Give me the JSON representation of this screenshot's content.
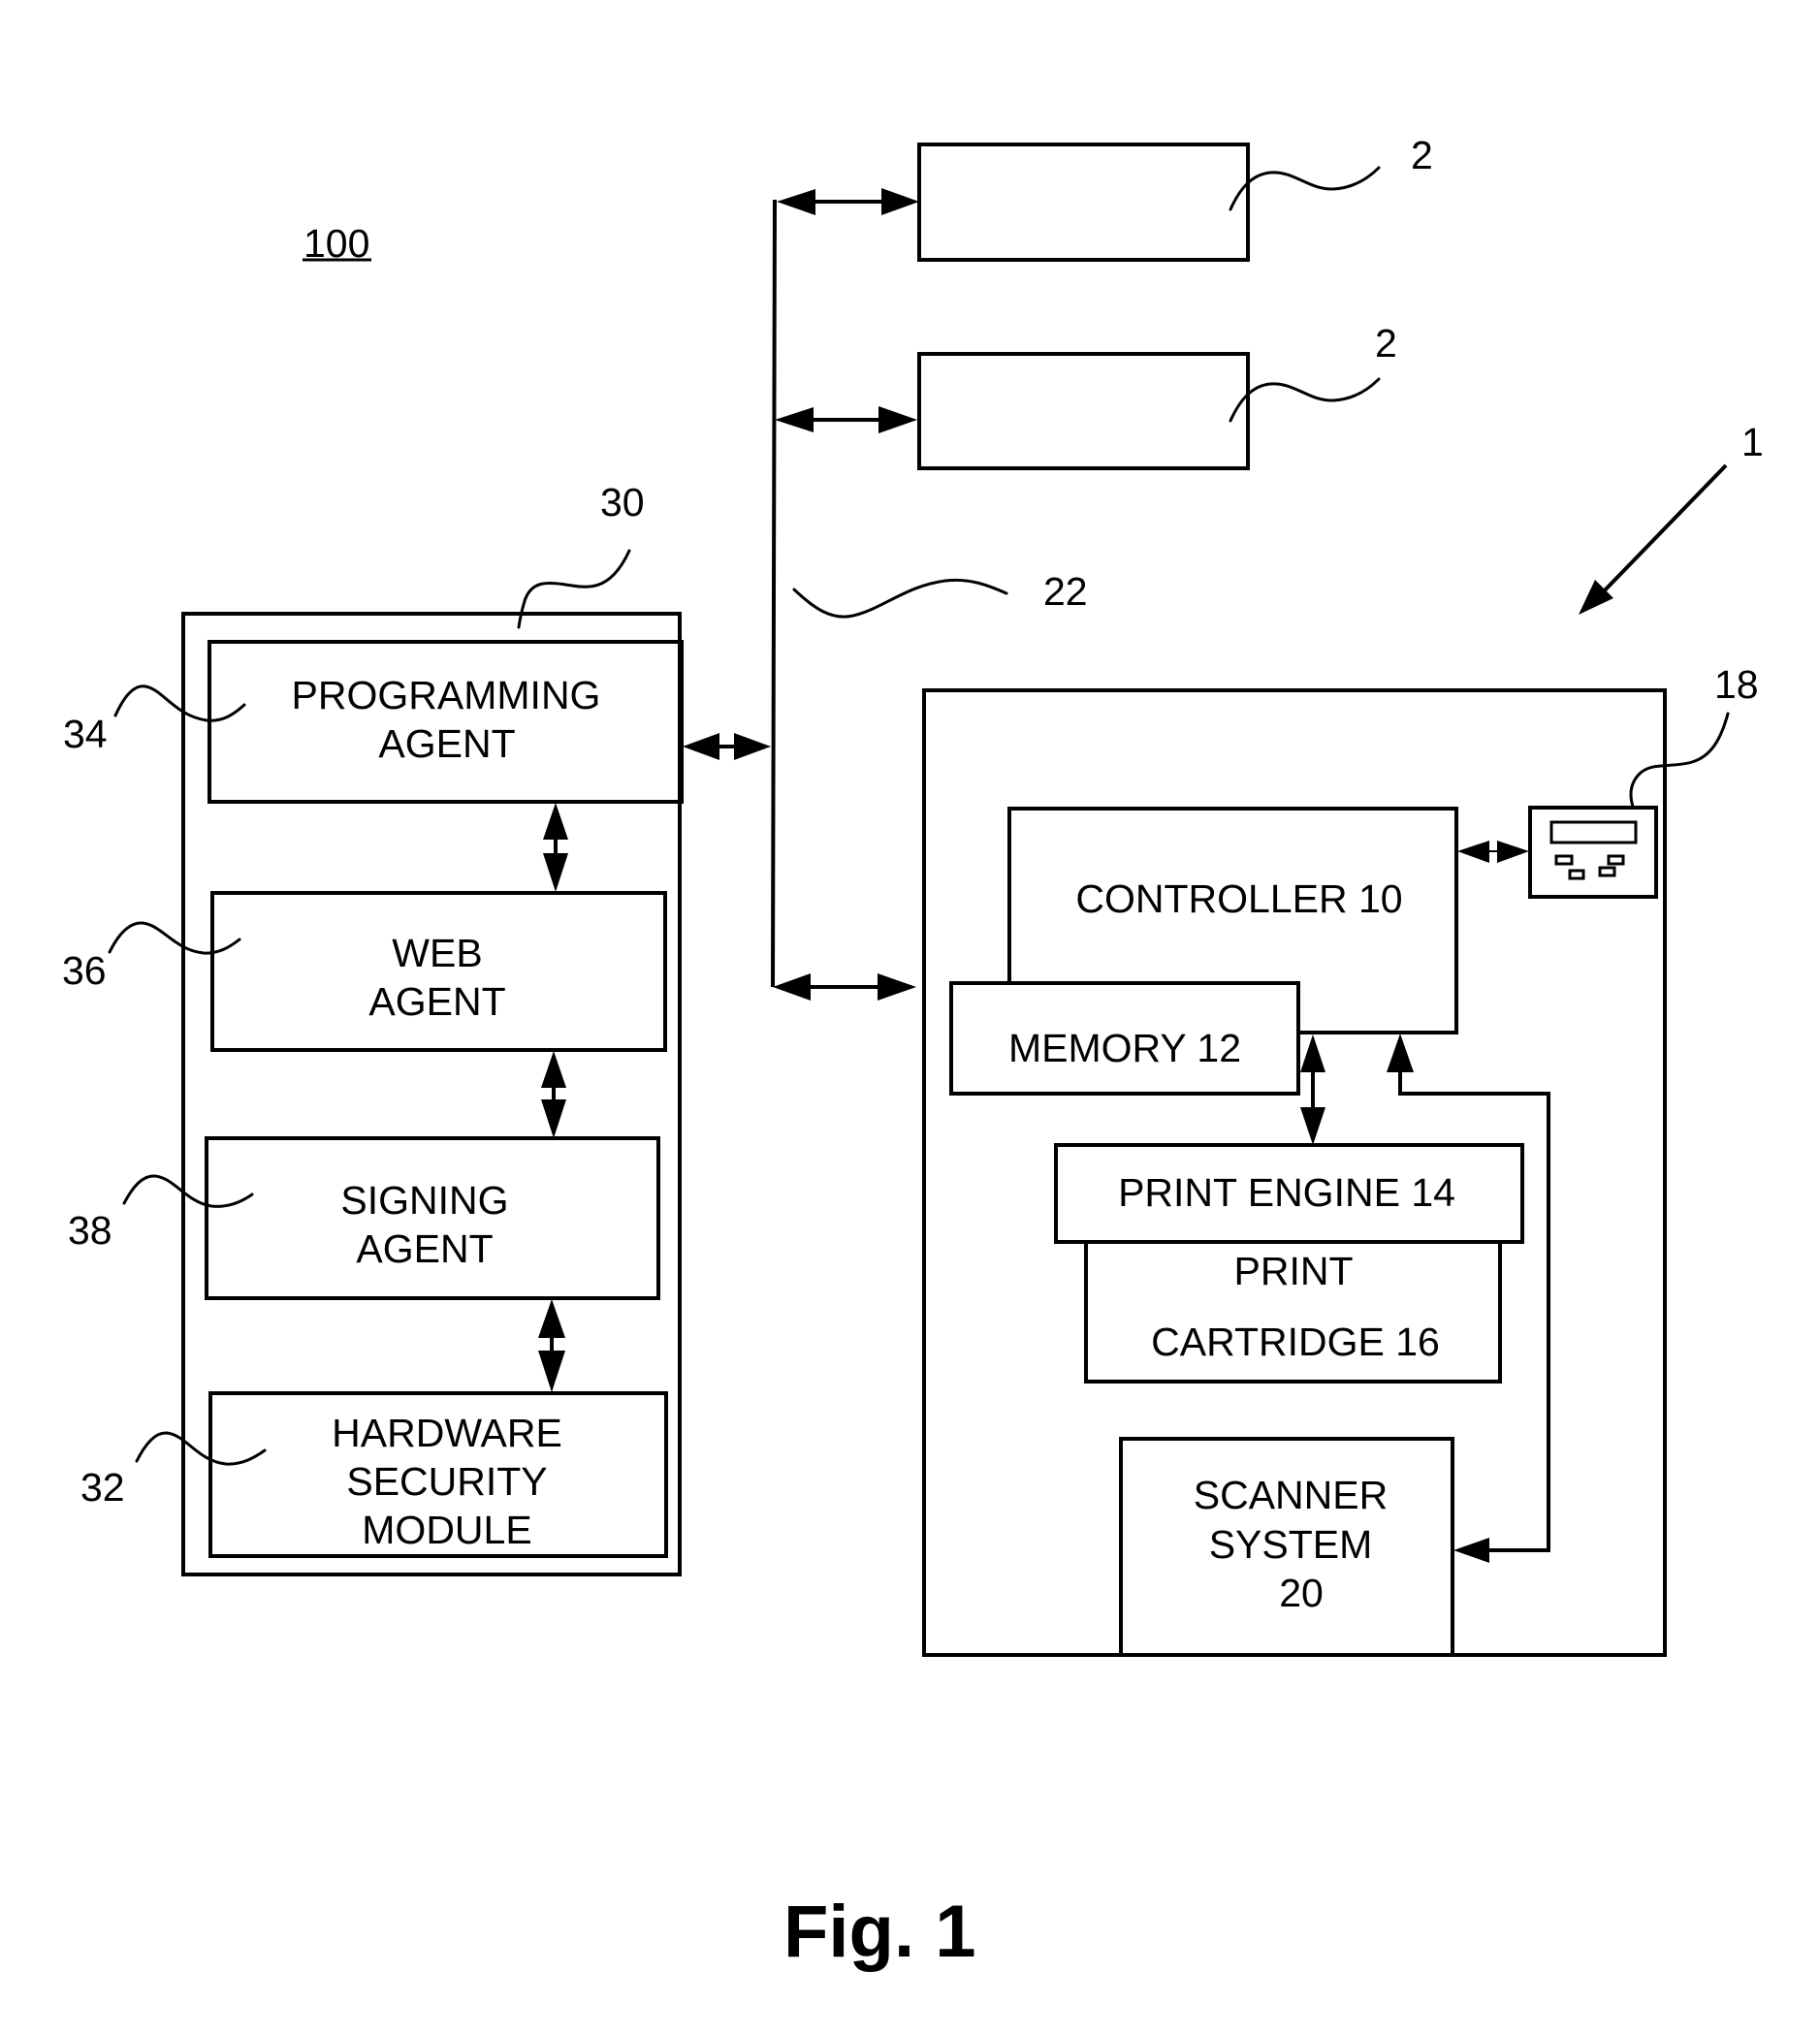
{
  "figure": {
    "system_ref": "100",
    "caption": "Fig. 1"
  },
  "left_system": {
    "ref": "30",
    "blocks": {
      "programming_agent": {
        "ref": "34",
        "lines": [
          "PROGRAMMING",
          "AGENT"
        ]
      },
      "web_agent": {
        "ref": "36",
        "lines": [
          "WEB",
          "AGENT"
        ]
      },
      "signing_agent": {
        "ref": "38",
        "lines": [
          "SIGNING",
          "AGENT"
        ]
      },
      "hardware_security_module": {
        "ref": "32",
        "lines": [
          "HARDWARE",
          "SECURITY",
          "MODULE"
        ]
      }
    }
  },
  "network": {
    "ref": "22"
  },
  "remote_devices": [
    {
      "ref": "2"
    },
    {
      "ref": "2"
    }
  ],
  "printer": {
    "ref": "1",
    "controller": "CONTROLLER 10",
    "memory": "MEMORY 12",
    "print_engine": "PRINT ENGINE 14",
    "print_cartridge": [
      "PRINT",
      "CARTRIDGE 16"
    ],
    "scanner_system": [
      "SCANNER",
      "SYSTEM",
      "20"
    ],
    "user_interface": {
      "ref": "18"
    }
  }
}
